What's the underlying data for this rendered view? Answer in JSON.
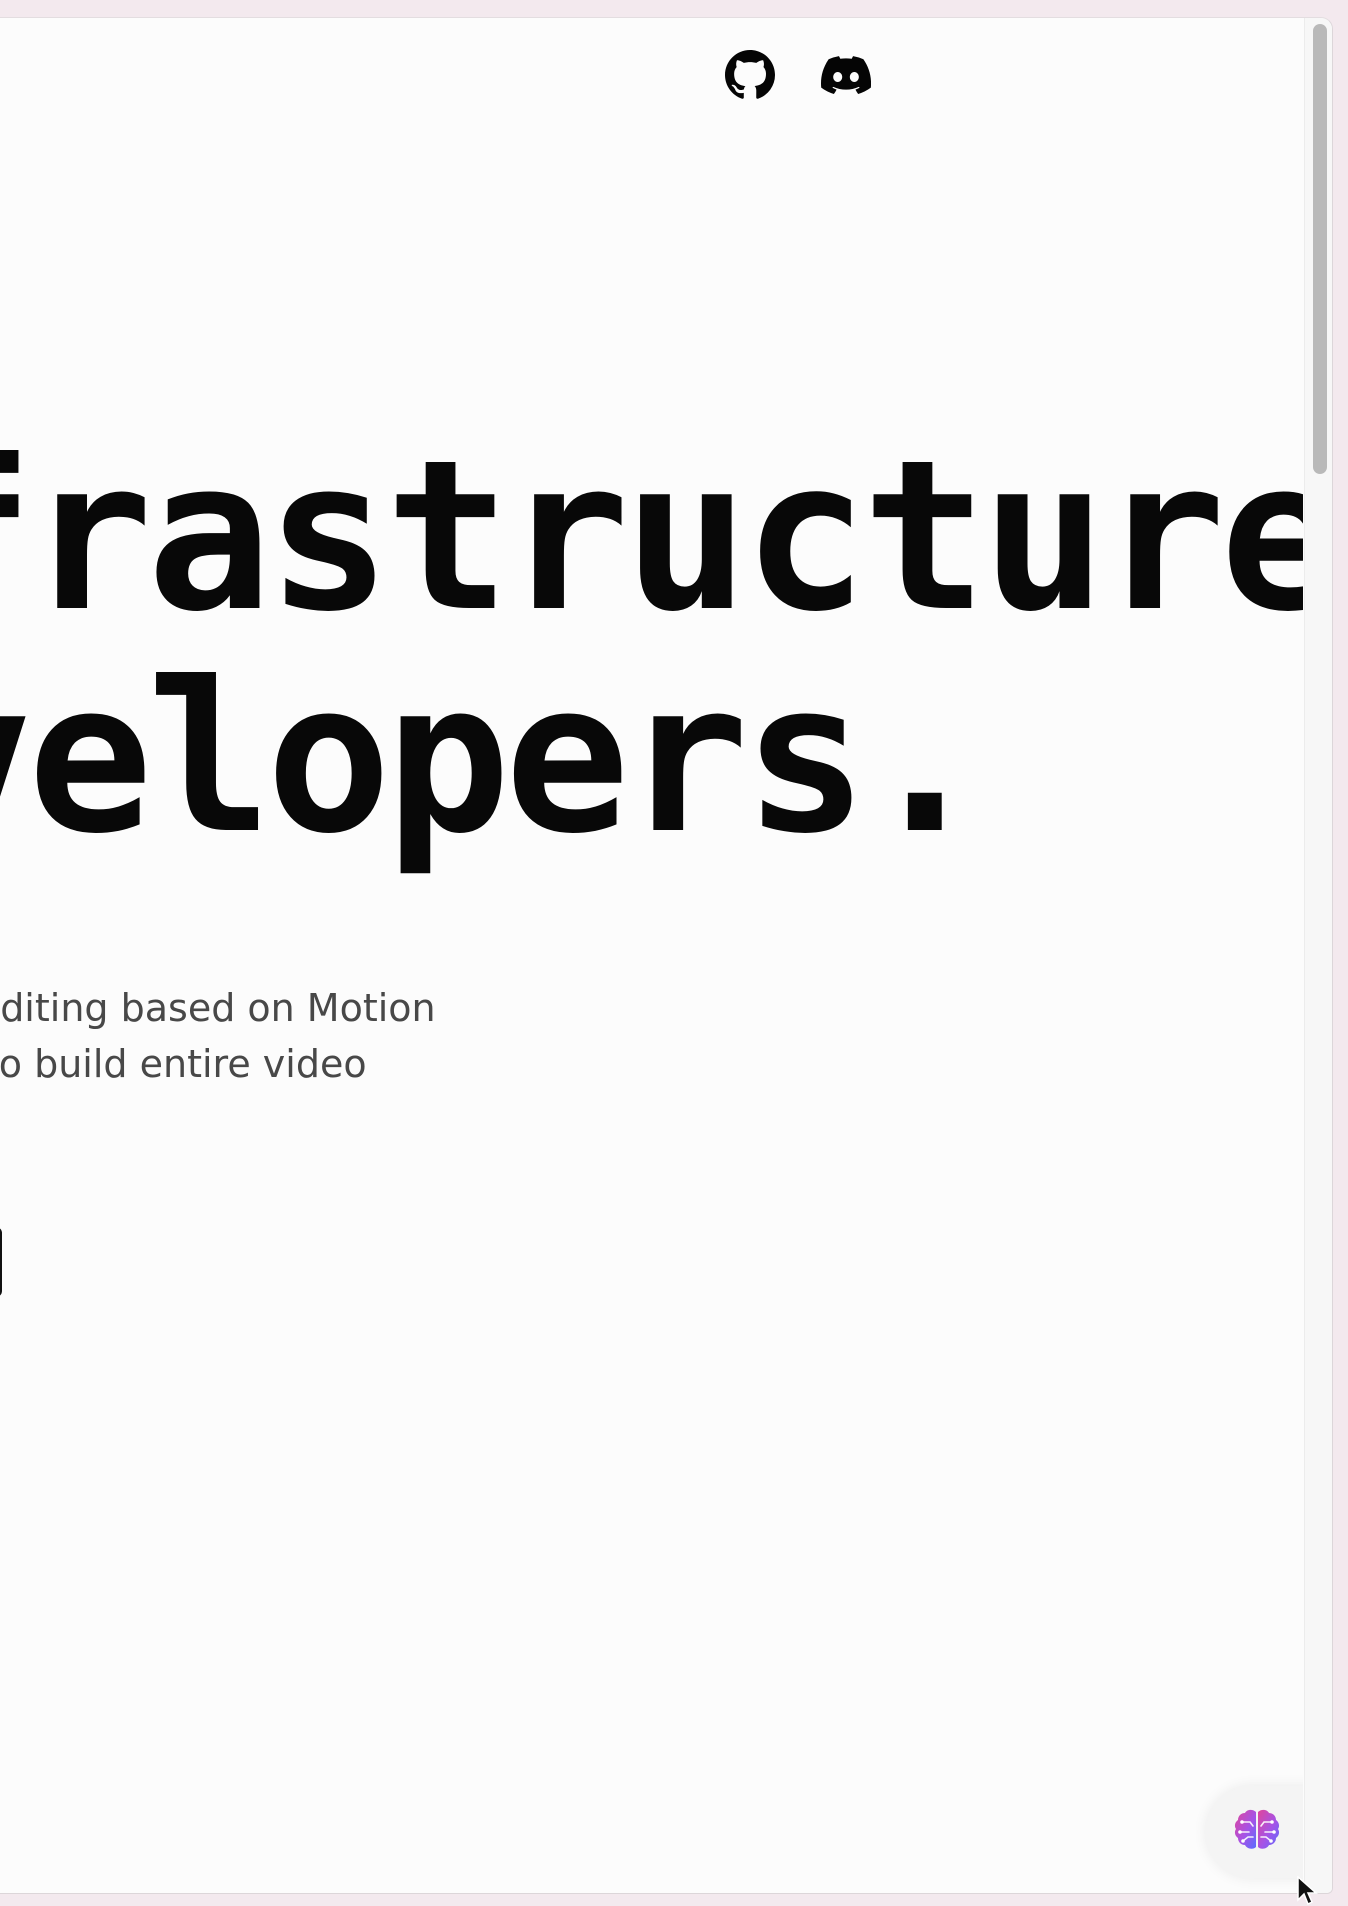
{
  "nav": {
    "icons": [
      "github-icon",
      "discord-icon"
    ]
  },
  "hero": {
    "line1": "infrastructure",
    "line2": "developers."
  },
  "subtitle": {
    "line1": "programmatic video editing based on Motion",
    "line2": "automation flows, or to build entire video"
  },
  "assistant": {
    "icon": "brain-icon"
  },
  "colors": {
    "page_background": "#fcfcfc",
    "heading": "#080808",
    "body_text": "#484848",
    "brain_gradient_start": "#e0459b",
    "brain_gradient_end": "#6a5cff"
  }
}
